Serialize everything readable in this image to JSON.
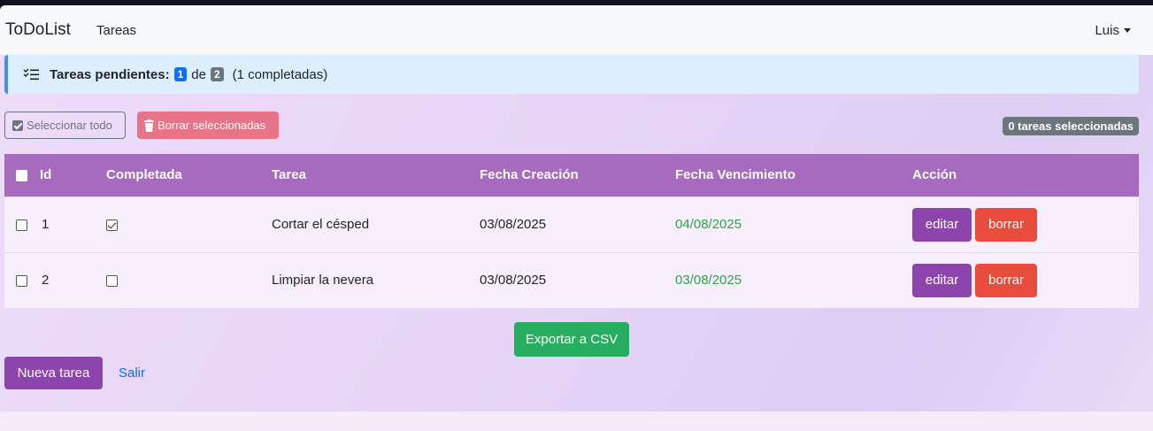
{
  "navbar": {
    "brand": "ToDoList",
    "tasks_link": "Tareas",
    "user": "Luis"
  },
  "alert": {
    "title": "Tareas pendientes:",
    "pending": "1",
    "of": "de",
    "total": "2",
    "completed_text": "(1 completadas)"
  },
  "toolbar": {
    "select_all": "Seleccionar todo",
    "delete_selected": "Borrar seleccionadas",
    "selected_count": "0 tareas seleccionadas"
  },
  "table": {
    "headers": {
      "id": "Id",
      "completed": "Completada",
      "task": "Tarea",
      "created": "Fecha Creación",
      "due": "Fecha Vencimiento",
      "action": "Acción"
    },
    "rows": [
      {
        "id": "1",
        "completed": true,
        "task": "Cortar el césped",
        "created": "03/08/2025",
        "due": "04/08/2025",
        "edit": "editar",
        "delete": "borrar"
      },
      {
        "id": "2",
        "completed": false,
        "task": "Limpiar la nevera",
        "created": "03/08/2025",
        "due": "03/08/2025",
        "edit": "editar",
        "delete": "borrar"
      }
    ]
  },
  "actions": {
    "export": "Exportar a CSV",
    "new_task": "Nueva tarea",
    "exit": "Salir"
  },
  "colors": {
    "header_purple": "#a66bbf",
    "primary_purple": "#8e44ad",
    "danger": "#e74c3c",
    "success": "#27ae60",
    "due_green": "#28a745"
  }
}
